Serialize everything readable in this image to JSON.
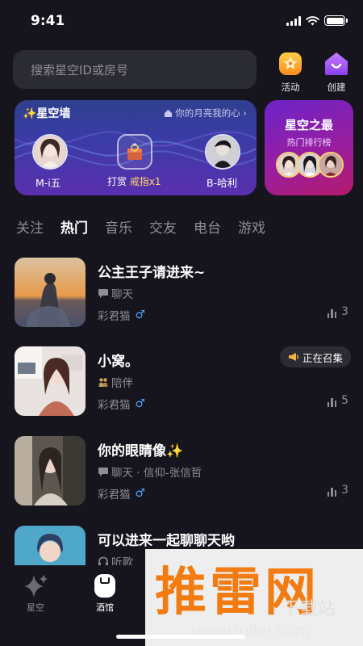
{
  "status": {
    "time": "9:41"
  },
  "search": {
    "placeholder": "搜索星空ID或房号"
  },
  "top_actions": [
    {
      "label": "活动",
      "icon": "star-badge-icon"
    },
    {
      "label": "创建",
      "icon": "home-plus-icon"
    }
  ],
  "star_wall": {
    "title": "✨星空墙",
    "link": "你的月亮我的心 ›",
    "left_user": "M-i五",
    "right_user": "B-哈利",
    "gift_prefix": "打赏 ",
    "gift_item": "戒指x1"
  },
  "star_best": {
    "title": "星空之最",
    "subtitle": "热门排行榜"
  },
  "tabs": [
    "关注",
    "热门",
    "音乐",
    "交友",
    "电台",
    "游戏"
  ],
  "active_tab": "热门",
  "rooms": [
    {
      "title": "公主王子请进来~",
      "tag": "聊天",
      "tag_icon": "chat-bubble-icon",
      "host": "彩君猫",
      "gender": "♂",
      "count": "3",
      "badge": ""
    },
    {
      "title": "小窝。",
      "tag": "陪伴",
      "tag_icon": "couple-icon",
      "host": "彩君猫",
      "gender": "♂",
      "count": "5",
      "badge": "正在召集"
    },
    {
      "title": "你的眼睛像✨",
      "tag": "聊天 · 信仰-张信哲",
      "tag_icon": "chat-bubble-icon",
      "host": "彩君猫",
      "gender": "♂",
      "count": "3",
      "badge": ""
    },
    {
      "title": "可以进来一起聊聊天哟",
      "tag": "听歌",
      "tag_icon": "headphones-icon",
      "host": "",
      "gender": "",
      "count": "",
      "badge": ""
    }
  ],
  "bottom_nav": [
    {
      "label": "星空",
      "icon": "sparkle-icon"
    },
    {
      "label": "酒馆",
      "icon": "tavern-icon"
    }
  ],
  "watermark": {
    "big": "推雷网",
    "url": "www.tuilei.com",
    "ghost": "下载站"
  },
  "colors": {
    "background": "#16151d",
    "accent_gold": "#ffd86a",
    "male_blue": "#4da3ff",
    "watermark_orange": "#f27c12"
  }
}
